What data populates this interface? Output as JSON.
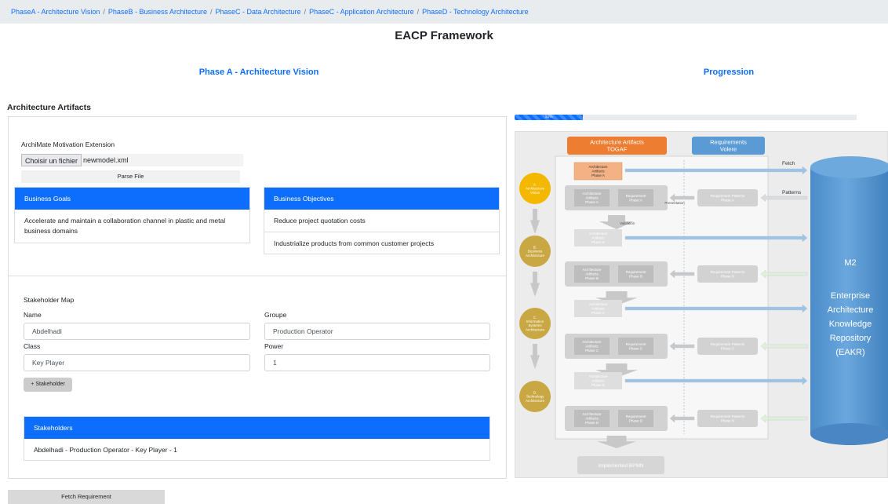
{
  "breadcrumb": [
    "PhaseA - Architecture Vision",
    "PhaseB - Business Architecture",
    "PhaseC - Data Architecture",
    "PhaseC - Application Architecture",
    "PhaseD - Technology Architecture"
  ],
  "breadcrumb_separator": "/",
  "page_title": "EACP Framework",
  "phase_title": "Phase A -  Architecture Vision",
  "progression_title": "Progression",
  "artifacts_title": "Architecture Artifacts",
  "motivation": {
    "label": "ArchiMate Motivation Extension",
    "choose_file_label": "Choisir un fichier",
    "file_name": "newmodel.xml",
    "parse_label": "Parse File"
  },
  "goals": {
    "header": "Business Goals",
    "items": [
      "Accelerate and maintain a collaboration channel in plastic and metal business domains"
    ]
  },
  "objectives": {
    "header": "Business Objectives",
    "items": [
      "Reduce project quotation costs",
      "Industrialize products from common customer projects"
    ]
  },
  "stakeholder_map": {
    "title": "Stakeholder Map",
    "name_label": "Name",
    "name_value": "Abdelhadi",
    "groupe_label": "Groupe",
    "groupe_value": "Production Operator",
    "class_label": "Class",
    "class_value": "Key Player",
    "power_label": "Power",
    "power_value": "1",
    "add_label": "+ Stakeholder"
  },
  "stakeholders": {
    "header": "Stakeholders",
    "items": [
      "Abdelhadi - Production Operator - Key Player - 1"
    ]
  },
  "fetch_label": "Fetch Requirement",
  "progress": {
    "value_percent": 10,
    "label": "10%"
  },
  "diagram": {
    "artifacts_header": [
      "Architecture Artifacts",
      "TOGAF"
    ],
    "requirements_header": [
      "Requirements",
      "Volere"
    ],
    "fetch_label": "Fetch",
    "patterns_label": "Patterns",
    "presentation_label": "Presentation",
    "validation_label": "Validation",
    "phase_a_artifact": [
      "Architecture",
      "Artifacts",
      "Phase A"
    ],
    "phases": [
      {
        "circle": [
          "A.",
          "Architecture",
          "Vision"
        ],
        "circle_color": "#f5b800",
        "artifact": [
          "Architecture",
          "Artifacts",
          "Phase A"
        ],
        "requirement": [
          "Requirement",
          "Phase A"
        ],
        "pattern": [
          "Requirement Patterns",
          "Phase A"
        ]
      },
      {
        "circle": [
          "B.",
          "Business",
          "Architecture"
        ],
        "circle_color": "#c9a843",
        "top_artifact": [
          "Architecture",
          "Artifacts",
          "Phase B"
        ],
        "artifact": [
          "Architecture",
          "Artifacts",
          "Phase B"
        ],
        "requirement": [
          "Requirement",
          "Phase B"
        ],
        "pattern": [
          "Requirement Patterns",
          "Phase B"
        ]
      },
      {
        "circle": [
          "C.",
          "Information",
          "Systems",
          "Architecture"
        ],
        "circle_color": "#c9a843",
        "top_artifact": [
          "Architecture",
          "Artifacts",
          "Phase C"
        ],
        "artifact": [
          "Architecture",
          "Artifacts",
          "Phase C"
        ],
        "requirement": [
          "Requirement",
          "Phase C"
        ],
        "pattern": [
          "Requirement Patterns",
          "Phase C"
        ]
      },
      {
        "circle": [
          "D.",
          "Technology",
          "Architecture"
        ],
        "circle_color": "#c9a843",
        "top_artifact": [
          "Architecture",
          "Artifacts",
          "Phase D"
        ],
        "artifact": [
          "Architecture",
          "Artifacts",
          "Phase D"
        ],
        "requirement": [
          "Requirement",
          "Phase D"
        ],
        "pattern": [
          "Requirement Patterns",
          "Phase D"
        ]
      }
    ],
    "implemented_label": "Implemented BPMN",
    "repository": {
      "code": "M2",
      "lines": [
        "Enterprise",
        "Architecture",
        "Knowledge",
        "Repository",
        "(EAKR)"
      ]
    },
    "colors": {
      "artifacts_header": "#ed7d31",
      "requirements_header": "#5b9bd5",
      "repository": "#5b9bd5",
      "arrow_blue": "#9dc3e6",
      "arrow_green": "#e2f0d9"
    }
  }
}
